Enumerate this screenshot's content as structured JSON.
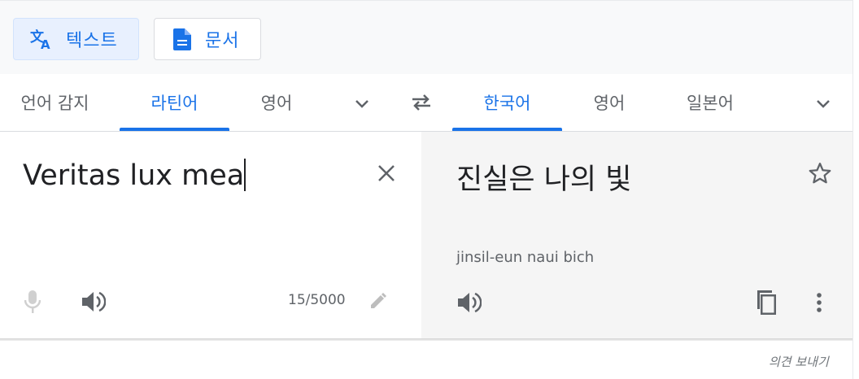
{
  "modes": {
    "text_label": "텍스트",
    "document_label": "문서"
  },
  "source_languages": {
    "tabs": [
      {
        "label": "언어 감지",
        "active": false
      },
      {
        "label": "라틴어",
        "active": true
      },
      {
        "label": "영어",
        "active": false
      }
    ]
  },
  "target_languages": {
    "tabs": [
      {
        "label": "한국어",
        "active": true
      },
      {
        "label": "영어",
        "active": false
      },
      {
        "label": "일본어",
        "active": false
      }
    ]
  },
  "source": {
    "text": "Veritas lux mea",
    "char_count": "15/5000"
  },
  "target": {
    "text": "진실은 나의 빛",
    "romanization": "jinsil-eun naui bich"
  },
  "footer": {
    "feedback_label": "의견 보내기"
  },
  "colors": {
    "accent": "#1a73e8",
    "active_bg": "#e8f0fe",
    "target_panel_bg": "#f5f5f5"
  },
  "icons": {
    "translate": "translate-icon",
    "document": "document-icon",
    "chevron": "chevron-down-icon",
    "swap": "swap-icon",
    "close": "close-icon",
    "mic": "mic-icon",
    "speaker": "speaker-icon",
    "pencil": "pencil-icon",
    "star": "star-icon",
    "copy": "copy-icon",
    "more": "more-vert-icon"
  }
}
